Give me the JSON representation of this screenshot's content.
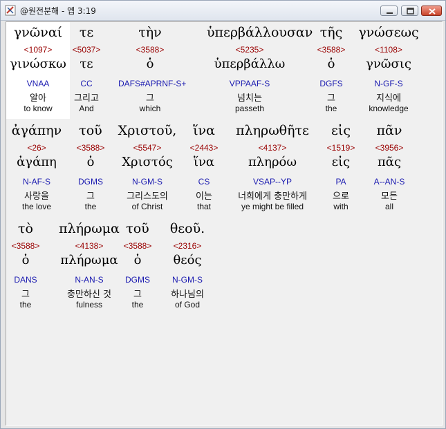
{
  "window": {
    "title": "@원전분해 - 엡 3:19",
    "icons": {
      "app": "app-icon",
      "minimize": "minimize-icon",
      "maximize": "maximize-icon",
      "close": "close-icon"
    },
    "colors": {
      "strong": "#990000",
      "parse": "#1a1ab0",
      "selected_bg": "#ffffff"
    }
  },
  "words": [
    {
      "greek": "γνῶναί",
      "strong": "<1097>",
      "lemma": "γινώσκω",
      "parse": "VNAA",
      "korean": "알아",
      "english": "to know",
      "selected": true
    },
    {
      "greek": "τε",
      "strong": "<5037>",
      "lemma": "τε",
      "parse": "CC",
      "korean": "그리고",
      "english": "And"
    },
    {
      "greek": "τὴν",
      "strong": "<3588>",
      "lemma": "ὁ",
      "parse": "DAFS#APRNF-S+",
      "korean": "그",
      "english": "which"
    },
    {
      "greek": "ὑπερβάλλουσαν",
      "strong": "<5235>",
      "lemma": "ὑπερβάλλω",
      "parse": "VPPAAF-S",
      "korean": "넘치는",
      "english": "passeth"
    },
    {
      "greek": "τῆς",
      "strong": "<3588>",
      "lemma": "ὁ",
      "parse": "DGFS",
      "korean": "그",
      "english": "the"
    },
    {
      "greek": "γνώσεως",
      "strong": "<1108>",
      "lemma": "γνῶσις",
      "parse": "N-GF-S",
      "korean": "지식에",
      "english": "knowledge"
    },
    {
      "greek": "ἀγάπην",
      "strong": "<26>",
      "lemma": "ἀγάπη",
      "parse": "N-AF-S",
      "korean": "사랑을",
      "english": "the love"
    },
    {
      "greek": "τοῦ",
      "strong": "<3588>",
      "lemma": "ὁ",
      "parse": "DGMS",
      "korean": "그",
      "english": "the"
    },
    {
      "greek": "Χριστοῦ,",
      "strong": "<5547>",
      "lemma": "Χριστός",
      "parse": "N-GM-S",
      "korean": "그리스도의",
      "english": "of Christ"
    },
    {
      "greek": "ἵνα",
      "strong": "<2443>",
      "lemma": "ἵνα",
      "parse": "CS",
      "korean": "이는",
      "english": "that"
    },
    {
      "greek": "πληρωθῆτε",
      "strong": "<4137>",
      "lemma": "πληρόω",
      "parse": "VSAP--YP",
      "korean": "너희에게 충만하게",
      "english": "ye might be filled"
    },
    {
      "greek": "εἰς",
      "strong": "<1519>",
      "lemma": "εἰς",
      "parse": "PA",
      "korean": "으로",
      "english": "with"
    },
    {
      "greek": "πᾶν",
      "strong": "<3956>",
      "lemma": "πᾶς",
      "parse": "A--AN-S",
      "korean": "모든",
      "english": "all"
    },
    {
      "greek": "τὸ",
      "strong": "<3588>",
      "lemma": "ὁ",
      "parse": "DANS",
      "korean": "그",
      "english": "the"
    },
    {
      "greek": "πλήρωμα",
      "strong": "<4138>",
      "lemma": "πλήρωμα",
      "parse": "N-AN-S",
      "korean": "충만하신 것",
      "english": "fulness"
    },
    {
      "greek": "τοῦ",
      "strong": "<3588>",
      "lemma": "ὁ",
      "parse": "DGMS",
      "korean": "그",
      "english": "the"
    },
    {
      "greek": "θεοῦ.",
      "strong": "<2316>",
      "lemma": "θεός",
      "parse": "N-GM-S",
      "korean": "하나님의",
      "english": "of God"
    }
  ]
}
